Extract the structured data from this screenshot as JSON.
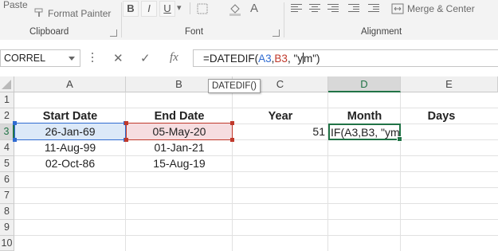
{
  "ribbon": {
    "paste_label": "Paste",
    "format_painter_label": "Format Painter",
    "clipboard_label": "Clipboard",
    "font_label": "Font",
    "alignment_label": "Alignment",
    "merge_center_label": "Merge & Center",
    "bold": "B",
    "italic": "I",
    "underline": "U",
    "underline_arrow": "▾",
    "font_color": "A",
    "fill_color": "A"
  },
  "formula_bar": {
    "name_box": "CORREL",
    "cancel_icon": "✕",
    "enter_icon": "✓",
    "fx_icon": "fx",
    "formula_prefix": "=DATEDIF(",
    "ref1": "A3",
    "comma1": ",",
    "ref2": "B3",
    "formula_suffix_before_caret": ", \"y",
    "formula_suffix_after_caret": "m\")"
  },
  "tooltip": "DATEDIF()",
  "columns": [
    "A",
    "B",
    "C",
    "D",
    "E"
  ],
  "rows": [
    "1",
    "2",
    "3",
    "4",
    "5",
    "6",
    "7",
    "8",
    "9",
    "10"
  ],
  "headers": {
    "start_date": "Start Date",
    "end_date": "End Date",
    "year": "Year",
    "month": "Month",
    "days": "Days"
  },
  "data": [
    {
      "start": "26-Jan-69",
      "end": "05-May-20"
    },
    {
      "start": "11-Aug-99",
      "end": "01-Jan-21"
    },
    {
      "start": "02-Oct-86",
      "end": "15-Aug-19"
    }
  ],
  "c3_value": "51",
  "d3_edit": "IF(A3,B3, \"ym'",
  "colors": {
    "excel_green": "#217346",
    "ref_blue": "#2f6bd1",
    "ref_red": "#c0392b"
  }
}
